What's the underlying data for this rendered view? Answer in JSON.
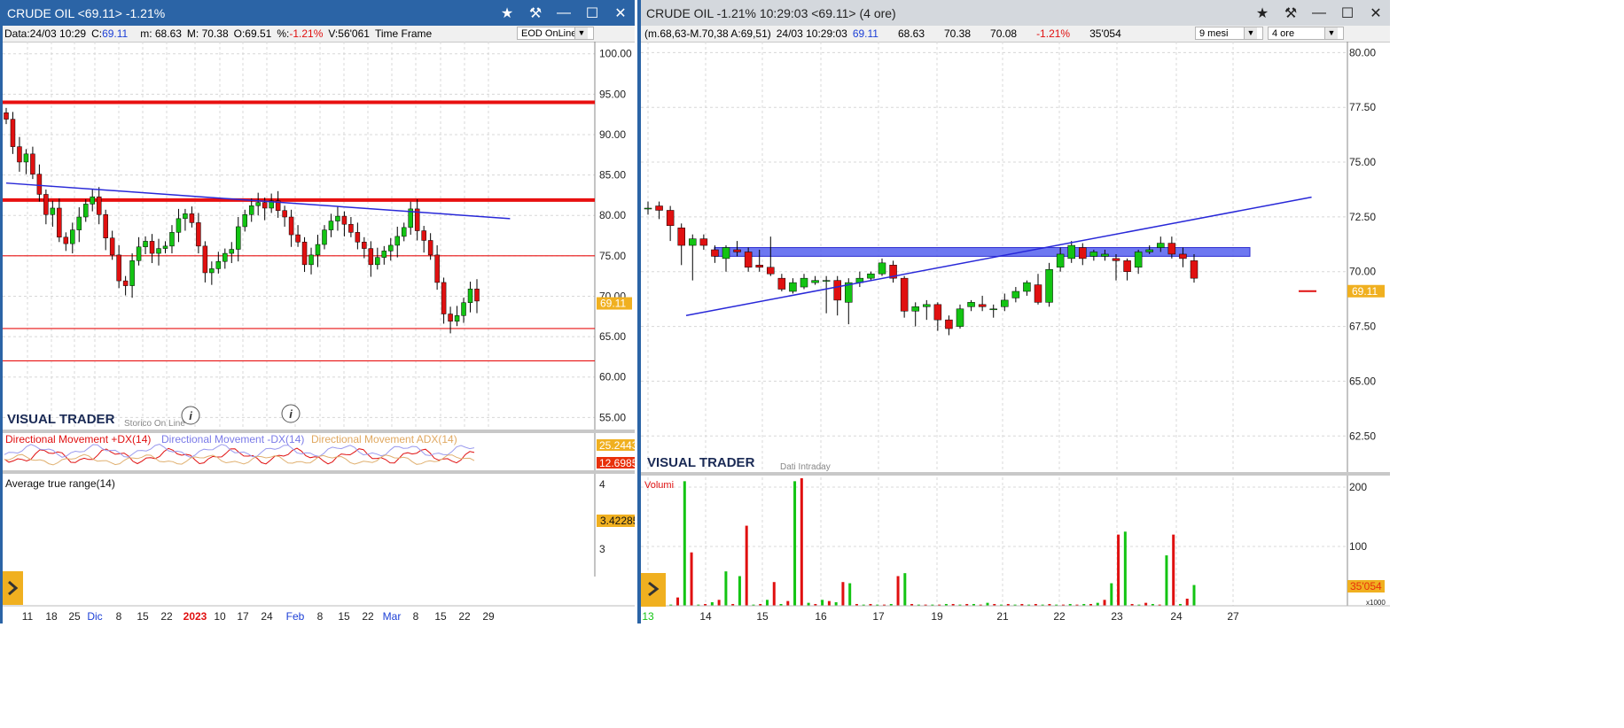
{
  "left_window": {
    "title": "CRUDE OIL <69.11> -1.21%",
    "info": {
      "data": "Data:24/03 10:29",
      "c_label": "C:",
      "c_value": "69.11",
      "m": "m: 68.63",
      "M": "M: 70.38",
      "O": "O:69.51",
      "pct_label": "%:",
      "pct_value": "-1.21%",
      "V": "V:56'061",
      "timeframe_label": "Time Frame",
      "timeframe_value": "EOD OnLine"
    },
    "brand": "VISUAL TRADER",
    "brand_sub": "Storico On Line",
    "indicator_labels": [
      "Directional Movement +DX(14)",
      "Directional Movement -DX(14)",
      "Directional Movement ADX(14)"
    ],
    "indicator_values": [
      "25.2443",
      "12.6985"
    ],
    "atr_label": "Average true range(14)",
    "atr_ticks": [
      "4",
      "3"
    ],
    "atr_value": "3.42285"
  },
  "right_window": {
    "title": "CRUDE OIL -1.21% 10:29:03  <69.11> (4 ore)",
    "info": {
      "mma": "(m.68,63-M.70,38 A:69,51)",
      "datetime": "24/03 10:29:03",
      "last": "69.11",
      "v1": "68.63",
      "v2": "70.38",
      "v3": "70.08",
      "pct": "-1.21%",
      "vol": "35'054"
    },
    "period_select": "9 mesi",
    "interval_select": "4 ore",
    "brand": "VISUAL TRADER",
    "brand_sub": "Dati Intraday",
    "volume_label": "Volumi",
    "volume_value": "35'054",
    "volume_unit": "x1000",
    "volume_ticks": [
      "200",
      "100"
    ]
  },
  "colors": {
    "up": "#13c413",
    "down": "#e01010",
    "accent": "#f0b020",
    "blue_title": "#2b64a6"
  },
  "chart_data": [
    {
      "type": "candlestick",
      "title": "CRUDE OIL <69.11> -1.21%",
      "timeframe": "daily",
      "x_ticks": [
        "11",
        "18",
        "25",
        "Dic",
        "8",
        "15",
        "22",
        "2023",
        "10",
        "17",
        "24",
        "Feb",
        "8",
        "15",
        "22",
        "Mar",
        "8",
        "15",
        "22",
        "29"
      ],
      "y_ticks": [
        "100.00",
        "95.00",
        "90.00",
        "85.00",
        "80.00",
        "75.00",
        "70.00",
        "65.00",
        "60.00",
        "55.00"
      ],
      "ylim": [
        53.5,
        101.5
      ],
      "last_price": "69.11",
      "series": [
        {
          "name": "close",
          "values": [
            91.9,
            88.5,
            86.6,
            87.6,
            85.1,
            82.6,
            80.1,
            80.9,
            77.3,
            76.5,
            78.2,
            79.8,
            81.4,
            82.3,
            80.1,
            77.2,
            75.1,
            71.9,
            71.3,
            74.4,
            76.1,
            76.8,
            75.3,
            75.9,
            76.2,
            77.9,
            79.6,
            80.2,
            79.1,
            76.2,
            72.9,
            73.4,
            74.3,
            75.3,
            75.8,
            78.6,
            80.1,
            81.2,
            81.6,
            80.9,
            81.8,
            80.6,
            79.8,
            77.6,
            76.7,
            73.9,
            75.1,
            76.4,
            78.2,
            79.3,
            79.9,
            78.9,
            77.9,
            76.7,
            75.9,
            73.9,
            74.8,
            75.6,
            76.3,
            77.4,
            78.5,
            80.8,
            78.1,
            76.9,
            75.1,
            71.7,
            67.8,
            66.9,
            67.6,
            69.2,
            70.9,
            69.4
          ]
        }
      ],
      "horizontal_lines": [
        94.0,
        81.9,
        75.0,
        66.0,
        62.0
      ],
      "trendline": {
        "from": [
          0,
          84.0
        ],
        "to": [
          76,
          79.6
        ]
      }
    },
    {
      "type": "candlestick",
      "title": "CRUDE OIL -1.21% 10:29:03 <69.11> (4 ore)",
      "timeframe": "4 ore",
      "x_ticks": [
        "13",
        "14",
        "15",
        "16",
        "17",
        "19",
        "21",
        "22",
        "23",
        "24",
        "27"
      ],
      "y_ticks": [
        "80.00",
        "77.50",
        "75.00",
        "72.50",
        "70.00",
        "67.50",
        "65.00",
        "62.50"
      ],
      "ylim": [
        61.5,
        80.5
      ],
      "last_price": "69.11",
      "series": [
        {
          "name": "candles",
          "values": [
            [
              72.9,
              72.9,
              73.2,
              72.6
            ],
            [
              73.0,
              72.8,
              73.2,
              72.4
            ],
            [
              72.8,
              72.1,
              73.0,
              71.4
            ],
            [
              72.0,
              71.2,
              72.2,
              70.3
            ],
            [
              71.2,
              71.5,
              71.7,
              69.6
            ],
            [
              71.5,
              71.2,
              71.7,
              71.0
            ],
            [
              71.0,
              70.7,
              71.2,
              70.4
            ],
            [
              70.6,
              71.1,
              71.2,
              70.0
            ],
            [
              71.0,
              70.9,
              71.4,
              70.7
            ],
            [
              70.9,
              70.2,
              71.1,
              70.0
            ],
            [
              70.3,
              70.2,
              71.0,
              70.0
            ],
            [
              70.2,
              69.9,
              71.6,
              69.8
            ],
            [
              69.7,
              69.2,
              69.9,
              69.1
            ],
            [
              69.1,
              69.5,
              69.7,
              69.0
            ],
            [
              69.3,
              69.7,
              69.9,
              69.2
            ],
            [
              69.5,
              69.6,
              69.8,
              69.4
            ],
            [
              69.6,
              69.6,
              69.8,
              68.1
            ],
            [
              69.6,
              68.7,
              69.8,
              68.0
            ],
            [
              68.6,
              69.5,
              69.7,
              67.6
            ],
            [
              69.5,
              69.7,
              70.0,
              69.3
            ],
            [
              69.7,
              69.9,
              70.0,
              69.6
            ],
            [
              69.9,
              70.4,
              70.6,
              69.8
            ],
            [
              70.3,
              69.7,
              70.5,
              69.5
            ],
            [
              69.7,
              68.2,
              69.8,
              67.9
            ],
            [
              68.2,
              68.4,
              68.6,
              67.5
            ],
            [
              68.4,
              68.5,
              68.7,
              67.8
            ],
            [
              68.5,
              67.8,
              68.6,
              67.3
            ],
            [
              67.8,
              67.4,
              68.0,
              67.1
            ],
            [
              67.5,
              68.3,
              68.5,
              67.4
            ],
            [
              68.4,
              68.6,
              68.7,
              68.2
            ],
            [
              68.5,
              68.4,
              68.9,
              68.2
            ],
            [
              68.3,
              68.3,
              68.5,
              67.9
            ],
            [
              68.4,
              68.7,
              69.0,
              68.2
            ],
            [
              68.8,
              69.1,
              69.3,
              68.6
            ],
            [
              69.1,
              69.5,
              69.6,
              68.9
            ],
            [
              69.4,
              68.6,
              69.9,
              68.5
            ],
            [
              68.6,
              70.1,
              70.4,
              68.4
            ],
            [
              70.2,
              70.8,
              71.1,
              70.0
            ],
            [
              70.6,
              71.2,
              71.4,
              70.4
            ],
            [
              71.1,
              70.6,
              71.3,
              70.3
            ],
            [
              70.7,
              70.9,
              71.0,
              70.5
            ],
            [
              70.7,
              70.8,
              71.0,
              70.5
            ],
            [
              70.6,
              70.5,
              70.8,
              69.6
            ],
            [
              70.5,
              70.0,
              70.6,
              69.6
            ],
            [
              70.2,
              70.9,
              71.0,
              69.9
            ],
            [
              70.9,
              71.0,
              71.2,
              70.8
            ],
            [
              71.1,
              71.3,
              71.6,
              70.9
            ],
            [
              71.3,
              70.8,
              71.6,
              70.6
            ],
            [
              70.8,
              70.6,
              71.1,
              70.2
            ],
            [
              70.5,
              69.7,
              70.8,
              69.5
            ]
          ]
        }
      ],
      "horizontal_band": [
        70.7,
        71.1
      ],
      "trendline": {
        "from": [
          0,
          68.0
        ],
        "to": [
          50,
          73.4
        ]
      },
      "volume": {
        "ylim": [
          0,
          215
        ],
        "values": [
          3,
          2,
          14,
          210,
          90,
          2,
          3,
          6,
          10,
          58,
          3,
          50,
          135,
          2,
          3,
          10,
          40,
          3,
          8,
          210,
          215,
          5,
          3,
          10,
          8,
          6,
          40,
          38,
          3,
          2,
          3,
          2,
          2,
          3,
          50,
          55,
          3,
          2,
          2,
          2,
          2,
          3,
          3,
          2,
          3,
          3,
          2,
          5,
          3,
          2,
          3,
          2,
          3,
          2,
          3,
          2,
          3,
          2,
          2,
          3,
          2,
          3,
          3,
          5,
          10,
          38,
          120,
          125,
          3,
          2,
          5,
          3,
          2,
          85,
          120,
          3,
          12,
          35
        ]
      }
    }
  ]
}
